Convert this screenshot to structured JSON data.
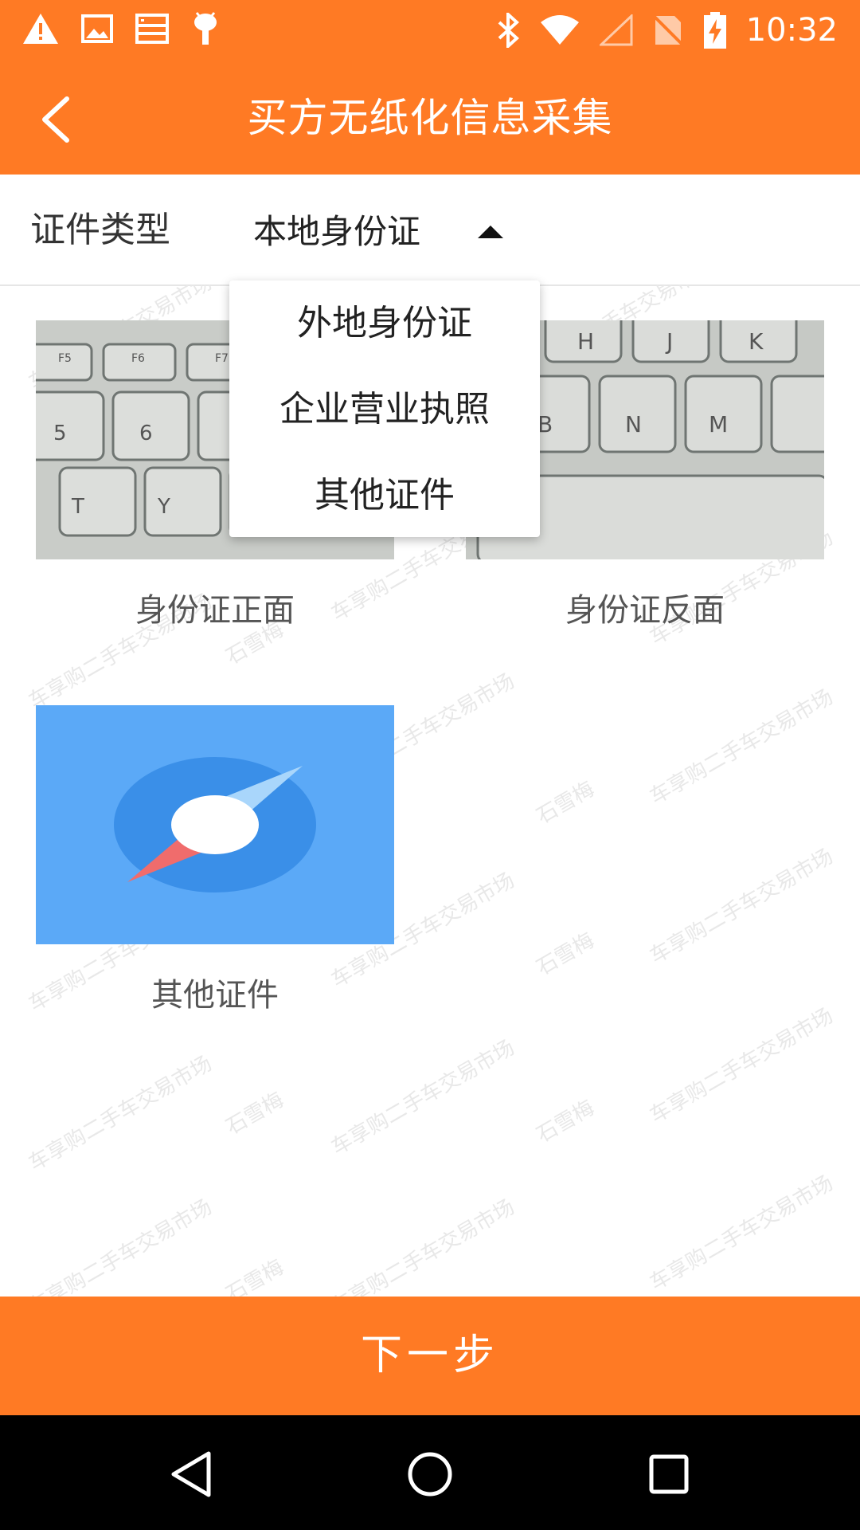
{
  "status_bar": {
    "time": "10:32",
    "left_icons": [
      "warning-icon",
      "image-icon",
      "storage-icon",
      "android-icon"
    ],
    "right_icons": [
      "bluetooth-icon",
      "wifi-icon",
      "signal-off-icon",
      "no-sim-icon",
      "battery-charging-icon"
    ]
  },
  "header": {
    "title": "买方无纸化信息采集",
    "back_icon": "chevron-left-icon"
  },
  "certificate": {
    "label": "证件类型",
    "selected": "本地身份证",
    "dropdown_options": [
      "外地身份证",
      "企业营业执照",
      "其他证件"
    ]
  },
  "photos": [
    {
      "caption": "身份证正面"
    },
    {
      "caption": "身份证反面"
    },
    {
      "caption": "其他证件"
    }
  ],
  "watermark": {
    "line1": "车享购二手车交易市场",
    "line2": "石雪梅"
  },
  "footer": {
    "next_label": "下一步"
  },
  "colors": {
    "brand": "#FF7A24",
    "nav_bar": "#000000"
  }
}
